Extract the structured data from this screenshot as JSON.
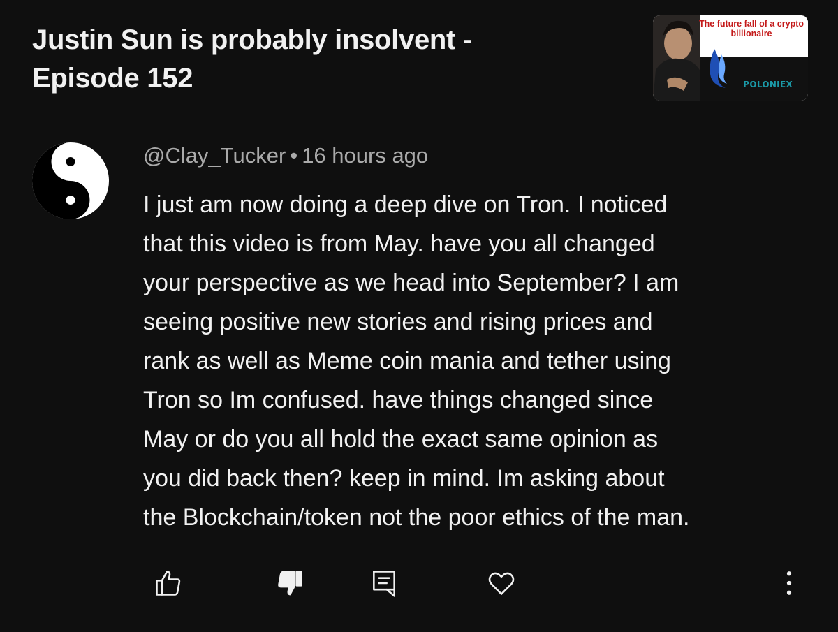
{
  "video": {
    "title": "Justin Sun is probably insolvent - Episode 152",
    "thumbnail": {
      "headline": "The future fall of a crypto billionaire",
      "brand": "POLONIEX"
    }
  },
  "comment": {
    "author": "@Clay_Tucker",
    "separator": "•",
    "time": "16 hours ago",
    "avatar_icon": "yin-yang-icon",
    "lines": [
      "I just am now doing a deep dive on Tron. I noticed",
      "that this video is from May. have you all changed",
      "your perspective as we head into September? I am",
      "seeing positive new stories and rising prices and",
      "rank as well as Meme coin mania and tether using",
      "Tron so Im confused. have things changed since",
      "May or do you all hold the exact same opinion as",
      "you did back then? keep in mind. Im asking about",
      "the Blockchain/token not the poor ethics of the man."
    ]
  },
  "actions": {
    "like_icon": "thumbs-up-icon",
    "dislike_icon": "thumbs-down-icon",
    "reply_icon": "reply-icon",
    "heart_icon": "heart-icon",
    "more_icon": "more-vertical-icon"
  },
  "colors": {
    "background": "#0f0f0f",
    "text_primary": "#f1f1f1",
    "text_secondary": "#aaaaaa"
  }
}
